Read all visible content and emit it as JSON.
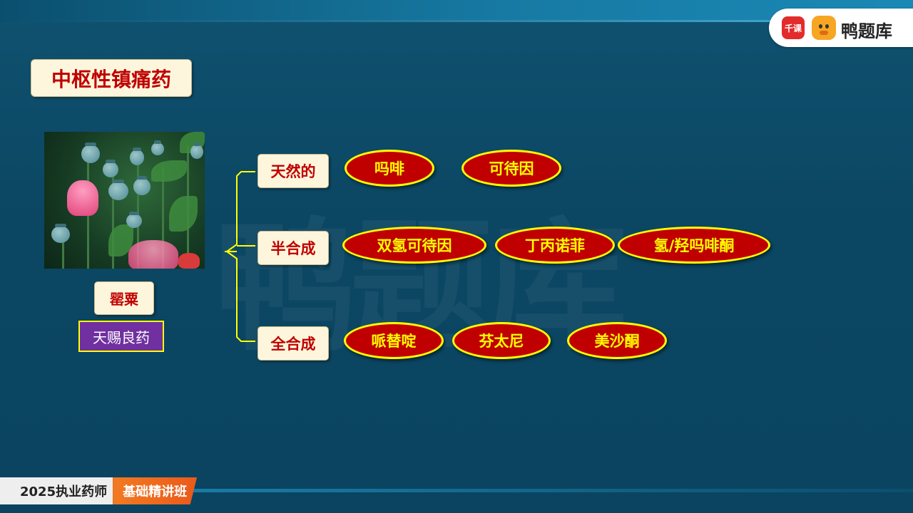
{
  "brand": {
    "qianke_label": "千课",
    "name": "鸭题库"
  },
  "slide": {
    "title": "中枢性镇痛药",
    "image_caption": "罂粟",
    "tagline": "天赐良药",
    "categories": [
      {
        "label": "天然的",
        "drugs": [
          "吗啡",
          "可待因"
        ]
      },
      {
        "label": "半合成",
        "drugs": [
          "双氢可待因",
          "丁丙诺菲",
          "氢/羟吗啡酮"
        ]
      },
      {
        "label": "全合成",
        "drugs": [
          "哌替啶",
          "芬太尼",
          "美沙酮"
        ]
      }
    ]
  },
  "course": {
    "year_label": "2025执业药师",
    "class_label": "基础精讲班"
  },
  "watermark": "鸭题库",
  "colors": {
    "background": "#0b4662",
    "title_text": "#c00000",
    "oval_fill": "#c00000",
    "oval_text": "#ffff00",
    "tag_fill": "#7030a0"
  }
}
